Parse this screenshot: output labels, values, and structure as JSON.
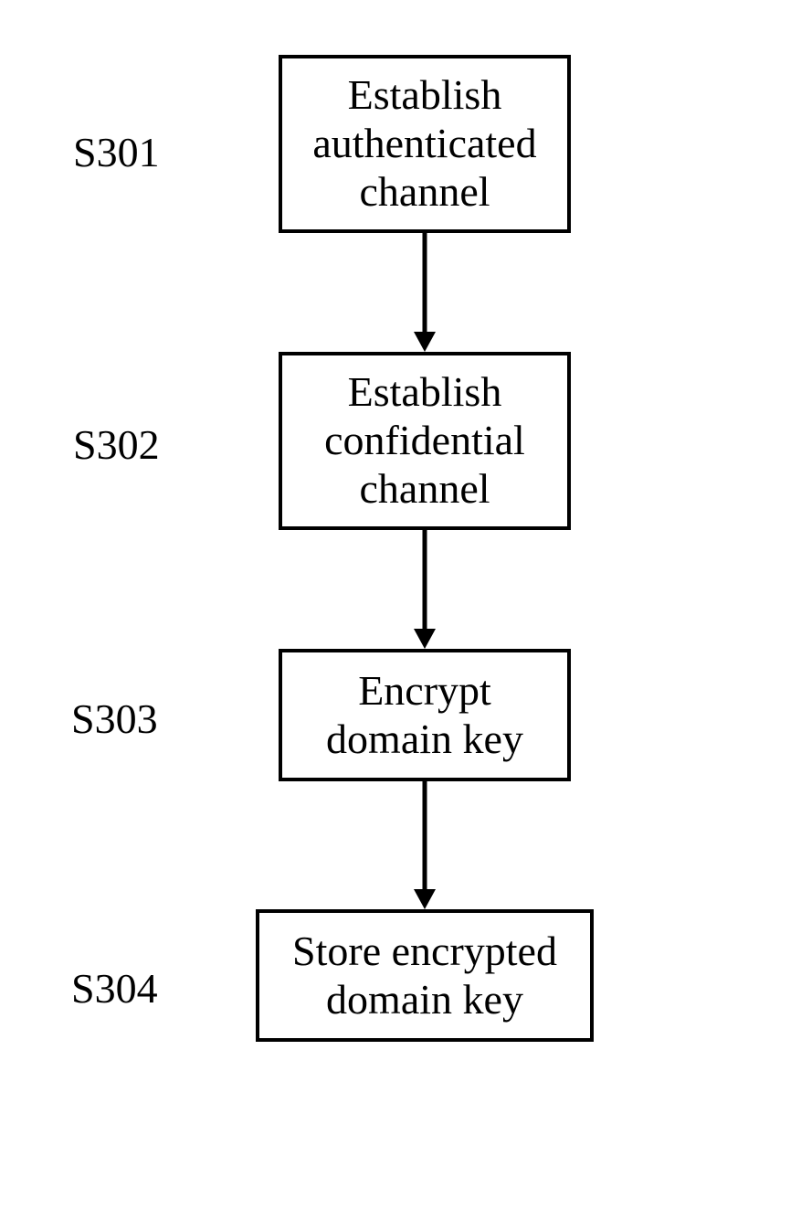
{
  "steps": [
    {
      "id": "S301",
      "label": "S301",
      "box_lines": [
        "Establish",
        "authenticated",
        "channel"
      ]
    },
    {
      "id": "S302",
      "label": "S302",
      "box_lines": [
        "Establish",
        "confidential",
        "channel"
      ]
    },
    {
      "id": "S303",
      "label": "S303",
      "box_lines": [
        "Encrypt",
        "domain key"
      ]
    },
    {
      "id": "S304",
      "label": "S304",
      "box_lines": [
        "Store encrypted",
        "domain key"
      ]
    }
  ]
}
